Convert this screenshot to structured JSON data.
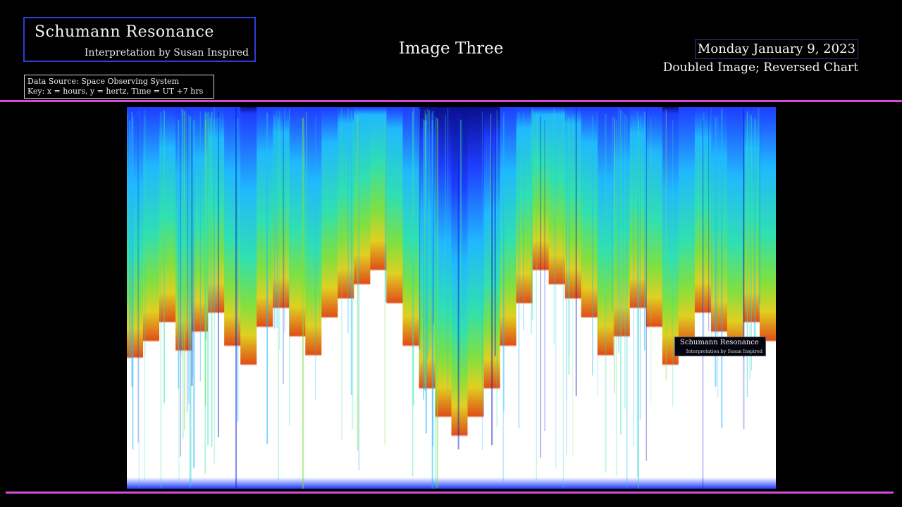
{
  "header": {
    "brand_title": "Schumann Resonance",
    "brand_subtitle": "Interpretation by Susan Inspired",
    "source_line1": "Data Source: Space Observing System",
    "source_line2": "Key: x = hours, y = hertz, Time = UT +7 hrs",
    "center_title": "Image Three",
    "date": "Monday January 9, 2023",
    "note": "Doubled Image; Reversed Chart"
  },
  "watermark": {
    "title": "Schumann Resonance",
    "subtitle": "Interpretation by Susan Inspired"
  },
  "colors": {
    "accent_rule": "#d64bd6",
    "title_border": "#2b3fd6",
    "background": "#000000"
  },
  "chart_data": {
    "type": "heatmap",
    "xlabel": "hours",
    "ylabel": "hertz",
    "mirrored": true,
    "colormap": [
      "#0a0f8f",
      "#1f3cff",
      "#20b8ff",
      "#30e0b0",
      "#7fe040",
      "#e0d020",
      "#e05018",
      "#ffffff"
    ],
    "intensity_profile": [
      0.55,
      0.62,
      0.7,
      0.58,
      0.66,
      0.74,
      0.6,
      0.52,
      0.68,
      0.76,
      0.64,
      0.56,
      0.72,
      0.8,
      0.86,
      0.92,
      0.78,
      0.6,
      0.42,
      0.3,
      0.22,
      0.3,
      0.42,
      0.6,
      0.78,
      0.92,
      0.86,
      0.8,
      0.72,
      0.56,
      0.64,
      0.76,
      0.68,
      0.52,
      0.6,
      0.74,
      0.66,
      0.58,
      0.7,
      0.62
    ]
  }
}
